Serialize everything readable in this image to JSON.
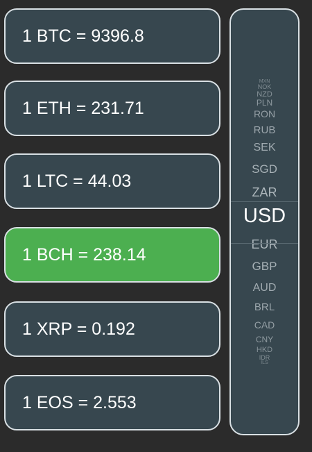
{
  "rates": [
    {
      "text": "1 BTC = 9396.8"
    },
    {
      "text": "1 ETH = 231.71"
    },
    {
      "text": "1 LTC = 44.03"
    },
    {
      "text": "1 BCH = 238.14"
    },
    {
      "text": "1 XRP = 0.192"
    },
    {
      "text": "1 EOS = 2.553"
    }
  ],
  "currency_picker": {
    "selected": "USD",
    "items_above": [
      "MXN",
      "NOK",
      "NZD",
      "PLN",
      "RON",
      "RUB",
      "SEK",
      "SGD",
      "ZAR"
    ],
    "items_below": [
      "EUR",
      "GBP",
      "AUD",
      "BRL",
      "CAD",
      "CNY",
      "HKD",
      "IDR",
      "ILS"
    ]
  },
  "colors": {
    "background": "#2b2b2b",
    "card": "#37474f",
    "card_border": "#d9e0e4",
    "active_card": "#4caf50",
    "picker_text": "#b3bcc1",
    "picker_selected_text": "#ffffff"
  }
}
